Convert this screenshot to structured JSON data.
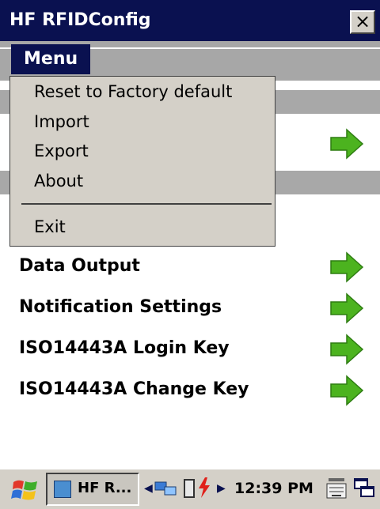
{
  "window": {
    "title": "HF RFIDConfig",
    "close_symbol": "×"
  },
  "menubar": {
    "menu_label": "Menu"
  },
  "menu": {
    "items": [
      "Reset to Factory default",
      "Import",
      "Export",
      "About"
    ],
    "exit": "Exit"
  },
  "list": {
    "items": [
      "Data Output",
      "Notification Settings",
      "ISO14443A Login Key",
      "ISO14443A Change Key"
    ]
  },
  "taskbar": {
    "app_button_label": "HF R...",
    "clock": "12:39 PM",
    "tray_left_arrow": "◀",
    "tray_right_arrow": "▶"
  },
  "colors": {
    "titlebar_bg": "#0a1150",
    "menubar_bg": "#a7a7a7",
    "dropdown_bg": "#d4d0c8",
    "arrow_green": "#4cb31f"
  }
}
